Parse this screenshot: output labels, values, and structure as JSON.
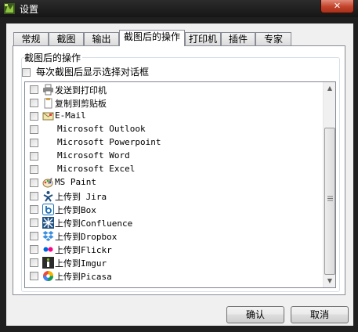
{
  "window": {
    "title": "设置",
    "close_label": "✕"
  },
  "tabs": [
    {
      "label": "常规",
      "active": false
    },
    {
      "label": "截图",
      "active": false
    },
    {
      "label": "输出",
      "active": false
    },
    {
      "label": "截图后的操作",
      "active": true
    },
    {
      "label": "打印机",
      "active": false
    },
    {
      "label": "插件",
      "active": false
    },
    {
      "label": "专家",
      "active": false
    }
  ],
  "group": {
    "label": "截图后的操作",
    "show_dialog": {
      "label": "每次截图后显示选择对话框",
      "checked": false
    }
  },
  "destinations": [
    {
      "label": "发送到打印机",
      "icon": "printer-icon",
      "checked": false
    },
    {
      "label": "复制到剪贴板",
      "icon": "clipboard-icon",
      "checked": false
    },
    {
      "label": "E-Mail",
      "icon": "email-icon",
      "checked": false
    },
    {
      "label": "Microsoft Outlook",
      "icon": "none",
      "checked": false
    },
    {
      "label": "Microsoft Powerpoint",
      "icon": "none",
      "checked": false
    },
    {
      "label": "Microsoft Word",
      "icon": "none",
      "checked": false
    },
    {
      "label": "Microsoft Excel",
      "icon": "none",
      "checked": false
    },
    {
      "label": "MS Paint",
      "icon": "paint-icon",
      "checked": false
    },
    {
      "label": "上传到 Jira",
      "icon": "jira-icon",
      "checked": false
    },
    {
      "label": "上传到Box",
      "icon": "box-icon",
      "checked": false
    },
    {
      "label": "上传到Confluence",
      "icon": "confluence-icon",
      "checked": false
    },
    {
      "label": "上传到Dropbox",
      "icon": "dropbox-icon",
      "checked": false
    },
    {
      "label": "上传到Flickr",
      "icon": "flickr-icon",
      "checked": false
    },
    {
      "label": "上传到Imgur",
      "icon": "imgur-icon",
      "checked": false
    },
    {
      "label": "上传到Picasa",
      "icon": "picasa-icon",
      "checked": false
    }
  ],
  "buttons": {
    "ok": "确认",
    "cancel": "取消"
  },
  "colors": {
    "titlebar": "#1f1f1f",
    "close": "#c2412a",
    "dropbox": "#3d8fde",
    "flickr_pink": "#ff0084",
    "flickr_blue": "#0063dc"
  }
}
